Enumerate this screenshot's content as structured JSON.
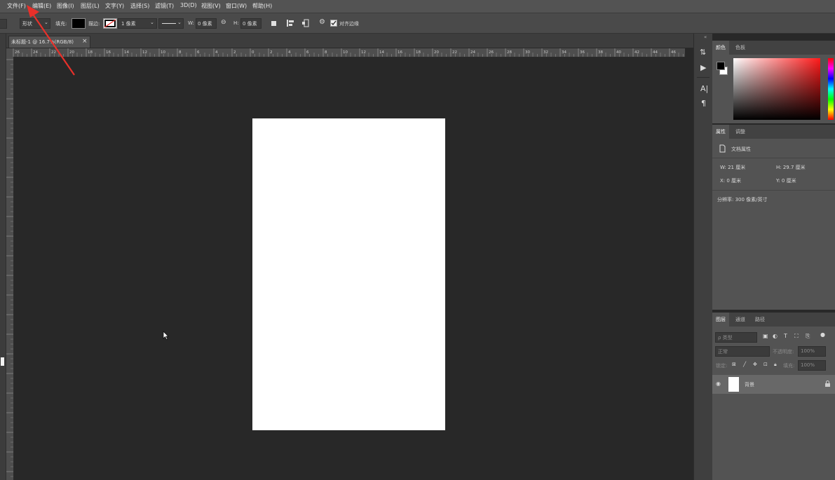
{
  "menu": [
    "文件(F)",
    "编辑(E)",
    "图像(I)",
    "图层(L)",
    "文字(Y)",
    "选择(S)",
    "滤镜(T)",
    "3D(D)",
    "视图(V)",
    "窗口(W)",
    "帮助(H)"
  ],
  "options": {
    "shape_mode": "形状",
    "fill_label": "填充:",
    "stroke_label": "描边:",
    "stroke_width": "1 像素",
    "w_label": "W:",
    "w_value": "0 像素",
    "h_label": "H:",
    "h_value": "0 像素",
    "align_edges": "对齐边缘"
  },
  "document": {
    "tab_title": "未标题-1 @ 16.7%(RGB/8)",
    "paper_color": "#ffffff"
  },
  "ruler_top": [
    "26",
    "24",
    "22",
    "20",
    "18",
    "16",
    "14",
    "12",
    "10",
    "8",
    "6",
    "4",
    "2",
    "0",
    "2",
    "4",
    "6",
    "8",
    "10",
    "12",
    "14",
    "16",
    "18",
    "20",
    "22",
    "24",
    "26",
    "28",
    "30",
    "32",
    "34",
    "36",
    "38",
    "40",
    "42",
    "44",
    "46"
  ],
  "color_panel": {
    "tabs": [
      "颜色",
      "色板"
    ],
    "foreground": "#000000",
    "background": "#ffffff"
  },
  "properties_panel": {
    "tabs": [
      "属性",
      "调整"
    ],
    "section": "文档属性",
    "w": "W: 21 厘米",
    "h": "H: 29.7 厘米",
    "x": "X: 0 厘米",
    "y": "Y: 0 厘米",
    "resolution": "分辨率: 300 像素/英寸"
  },
  "layers_panel": {
    "tabs": [
      "图层",
      "通道",
      "路径"
    ],
    "kind": "ρ 类型",
    "blend_mode": "正常",
    "opacity_label": "不透明度:",
    "opacity_value": "100%",
    "lock_label": "锁定:",
    "fill_label": "填充:",
    "fill_value": "100%",
    "layers": [
      {
        "name": "背景",
        "visible": true,
        "locked": true
      }
    ]
  },
  "annotation_color": "#e8302a"
}
